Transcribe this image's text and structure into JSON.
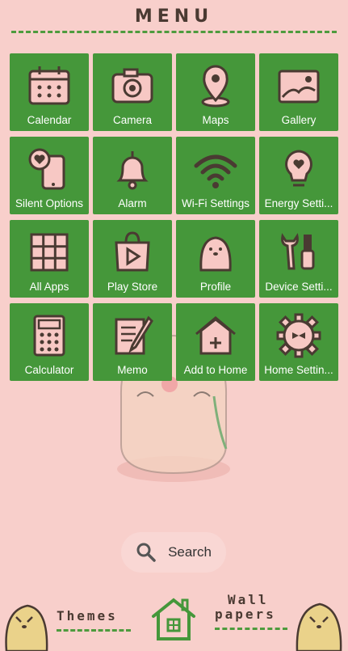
{
  "header": {
    "title": "MENU"
  },
  "tiles": [
    {
      "label": "Calendar",
      "icon": "calendar-icon"
    },
    {
      "label": "Camera",
      "icon": "camera-icon"
    },
    {
      "label": "Maps",
      "icon": "map-pin-icon"
    },
    {
      "label": "Gallery",
      "icon": "gallery-icon"
    },
    {
      "label": "Silent Options",
      "icon": "phone-heart-icon"
    },
    {
      "label": "Alarm",
      "icon": "bell-icon"
    },
    {
      "label": "Wi-Fi Settings",
      "icon": "wifi-icon"
    },
    {
      "label": "Energy Setti...",
      "icon": "bulb-heart-icon"
    },
    {
      "label": "All Apps",
      "icon": "grid-icon"
    },
    {
      "label": "Play Store",
      "icon": "play-store-bag-icon"
    },
    {
      "label": "Profile",
      "icon": "profile-character-icon"
    },
    {
      "label": "Device Setti...",
      "icon": "tools-icon"
    },
    {
      "label": "Calculator",
      "icon": "calculator-icon"
    },
    {
      "label": "Memo",
      "icon": "memo-pencil-icon"
    },
    {
      "label": "Add to Home",
      "icon": "house-plus-icon"
    },
    {
      "label": "Home Settin...",
      "icon": "gear-icon"
    }
  ],
  "search": {
    "label": "Search"
  },
  "footer": {
    "themes_label": "Themes",
    "wallpapers_line1": "Wall",
    "wallpapers_line2": "papers"
  },
  "colors": {
    "tile_green": "#45973a",
    "background_pink": "#f8cfcb",
    "dash_green": "#4e9b3e",
    "ink": "#4a3a32"
  }
}
